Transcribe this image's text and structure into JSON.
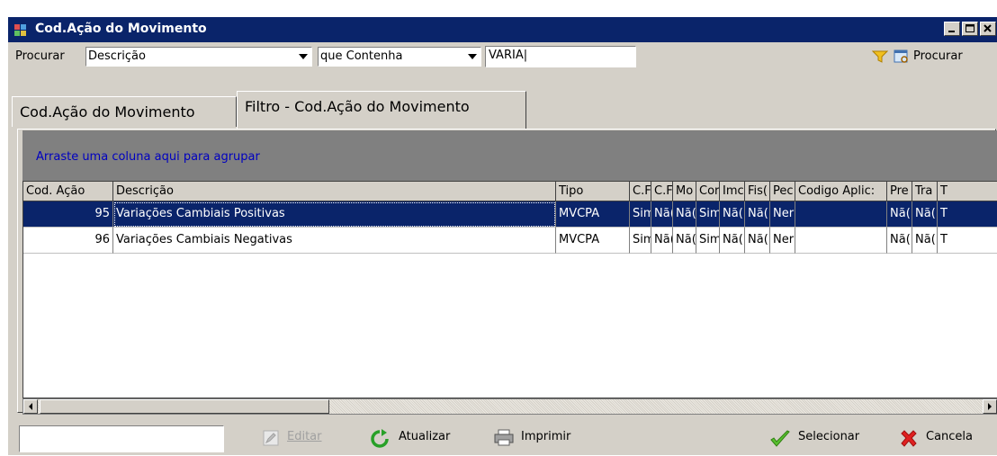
{
  "window": {
    "title": "Cod.Ação do Movimento"
  },
  "search": {
    "label": "Procurar",
    "field_value": "Descrição",
    "operator_value": "que Contenha",
    "text_value": "VARIA",
    "button_label": "Procurar"
  },
  "tabs": [
    {
      "label": "Cod.Ação do Movimento"
    },
    {
      "label": "Filtro - Cod.Ação do Movimento"
    }
  ],
  "grid": {
    "group_hint": "Arraste uma coluna aqui para agrupar",
    "columns": [
      "Cod. Ação",
      "Descrição",
      "Tipo",
      "C.F",
      "C.F",
      "Mo",
      "Cor",
      "Imc",
      "Fis(",
      "Pec",
      "Codigo Aplic:",
      "Pre",
      "Tra",
      "T"
    ],
    "rows": [
      [
        "95",
        "Variações Cambiais Positivas",
        "MVCPA",
        "Sim",
        "Nã(",
        "Nã(",
        "Sim",
        "Nã(",
        "Nã(",
        "Ner",
        "",
        "Nã(",
        "Nã(",
        "T"
      ],
      [
        "96",
        "Variações Cambiais Negativas",
        "MVCPA",
        "Sim",
        "Nã(",
        "Nã(",
        "Sim",
        "Nã(",
        "Nã(",
        "Ner",
        "",
        "Nã(",
        "Nã(",
        "T"
      ]
    ]
  },
  "footer": {
    "edit_label": "Editar",
    "refresh_label": "Atualizar",
    "print_label": "Imprimir",
    "select_label": "Selecionar",
    "cancel_label": "Cancela"
  },
  "colors": {
    "titlebar": "#0a246a",
    "selection": "#0a246a",
    "group_area": "#808080",
    "face": "#d4d0c8"
  }
}
